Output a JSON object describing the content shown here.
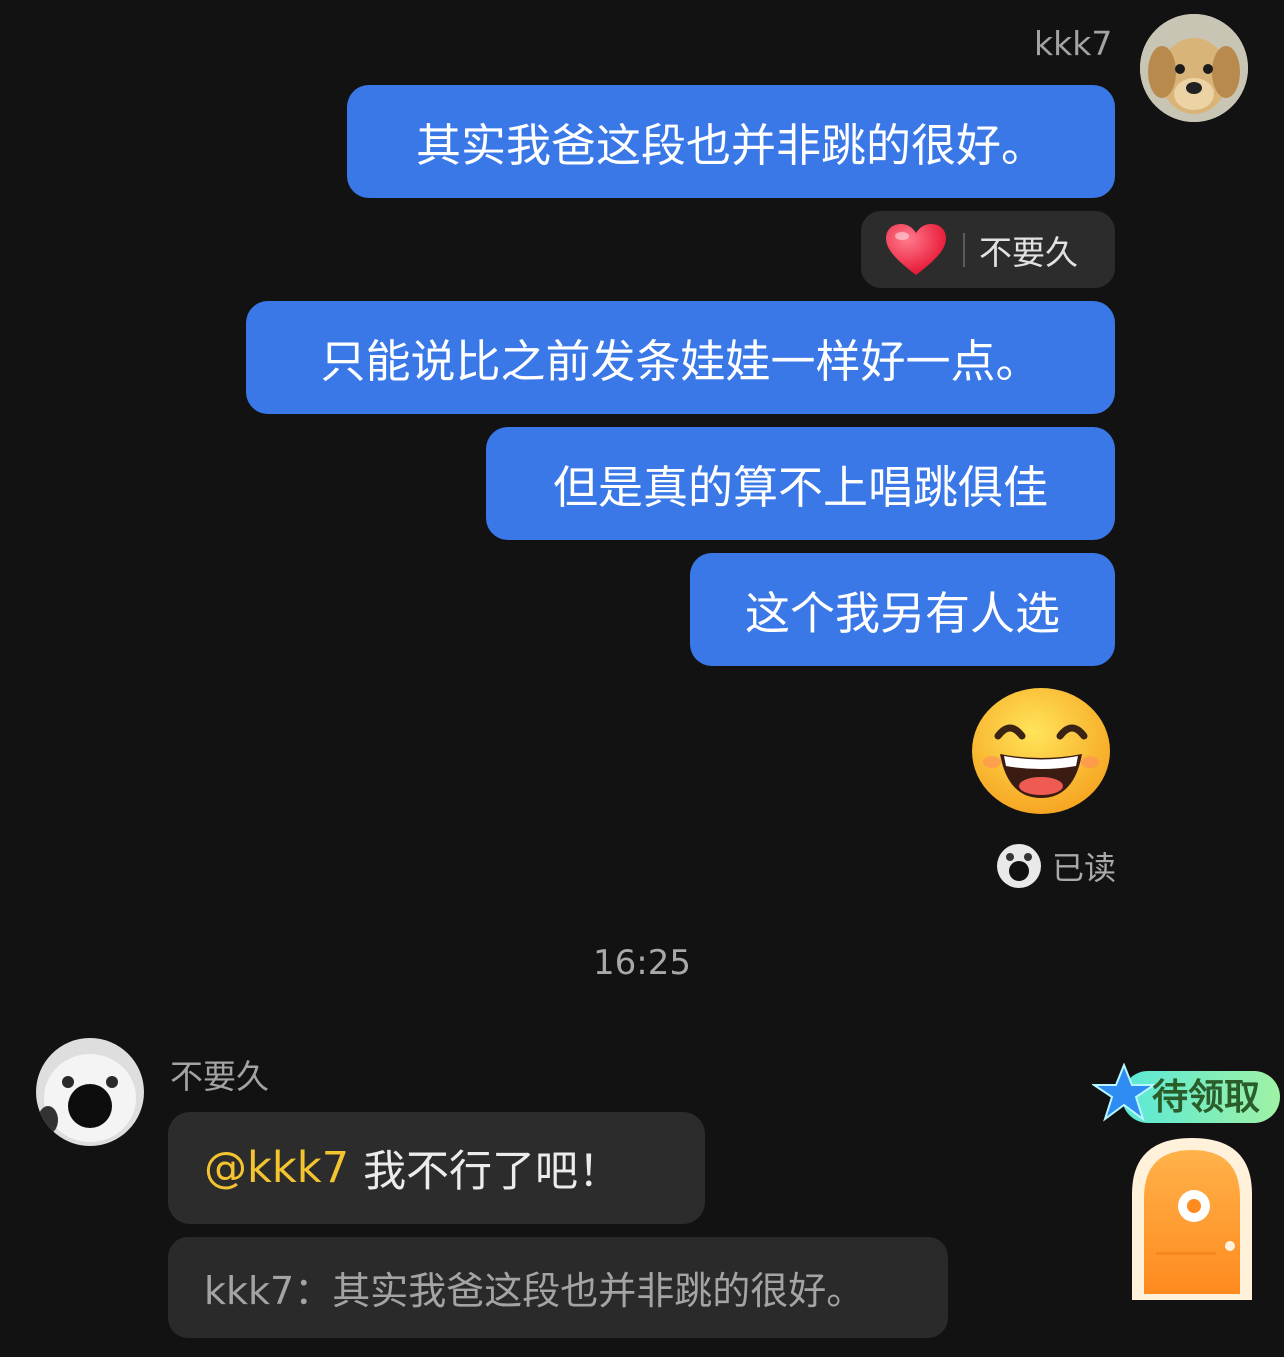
{
  "chat": {
    "me": {
      "name": "kkk7"
    },
    "messages_out": [
      "其实我爸这段也并非跳的很好。",
      "只能说比之前发条娃娃一样好一点。",
      "但是真的算不上唱跳俱佳",
      "这个我另有人选"
    ],
    "reaction": {
      "who": "不要久",
      "emoji": "heart"
    },
    "read_status": "已读",
    "timestamp": "16:25",
    "other": {
      "name": "不要久"
    },
    "incoming": {
      "mention": "@kkk7",
      "text": "我不行了吧！"
    },
    "quote": "kkk7：其实我爸这段也并非跳的很好。"
  },
  "widget": {
    "badge_label": "待领取"
  },
  "colors": {
    "background": "#121212",
    "bubble_out": "#3a78e8",
    "bubble_in": "#2c2c2c",
    "mention": "#f4c430"
  },
  "icons": [
    "heart-icon",
    "grin-emoji-icon",
    "door-icon",
    "star-icon"
  ]
}
